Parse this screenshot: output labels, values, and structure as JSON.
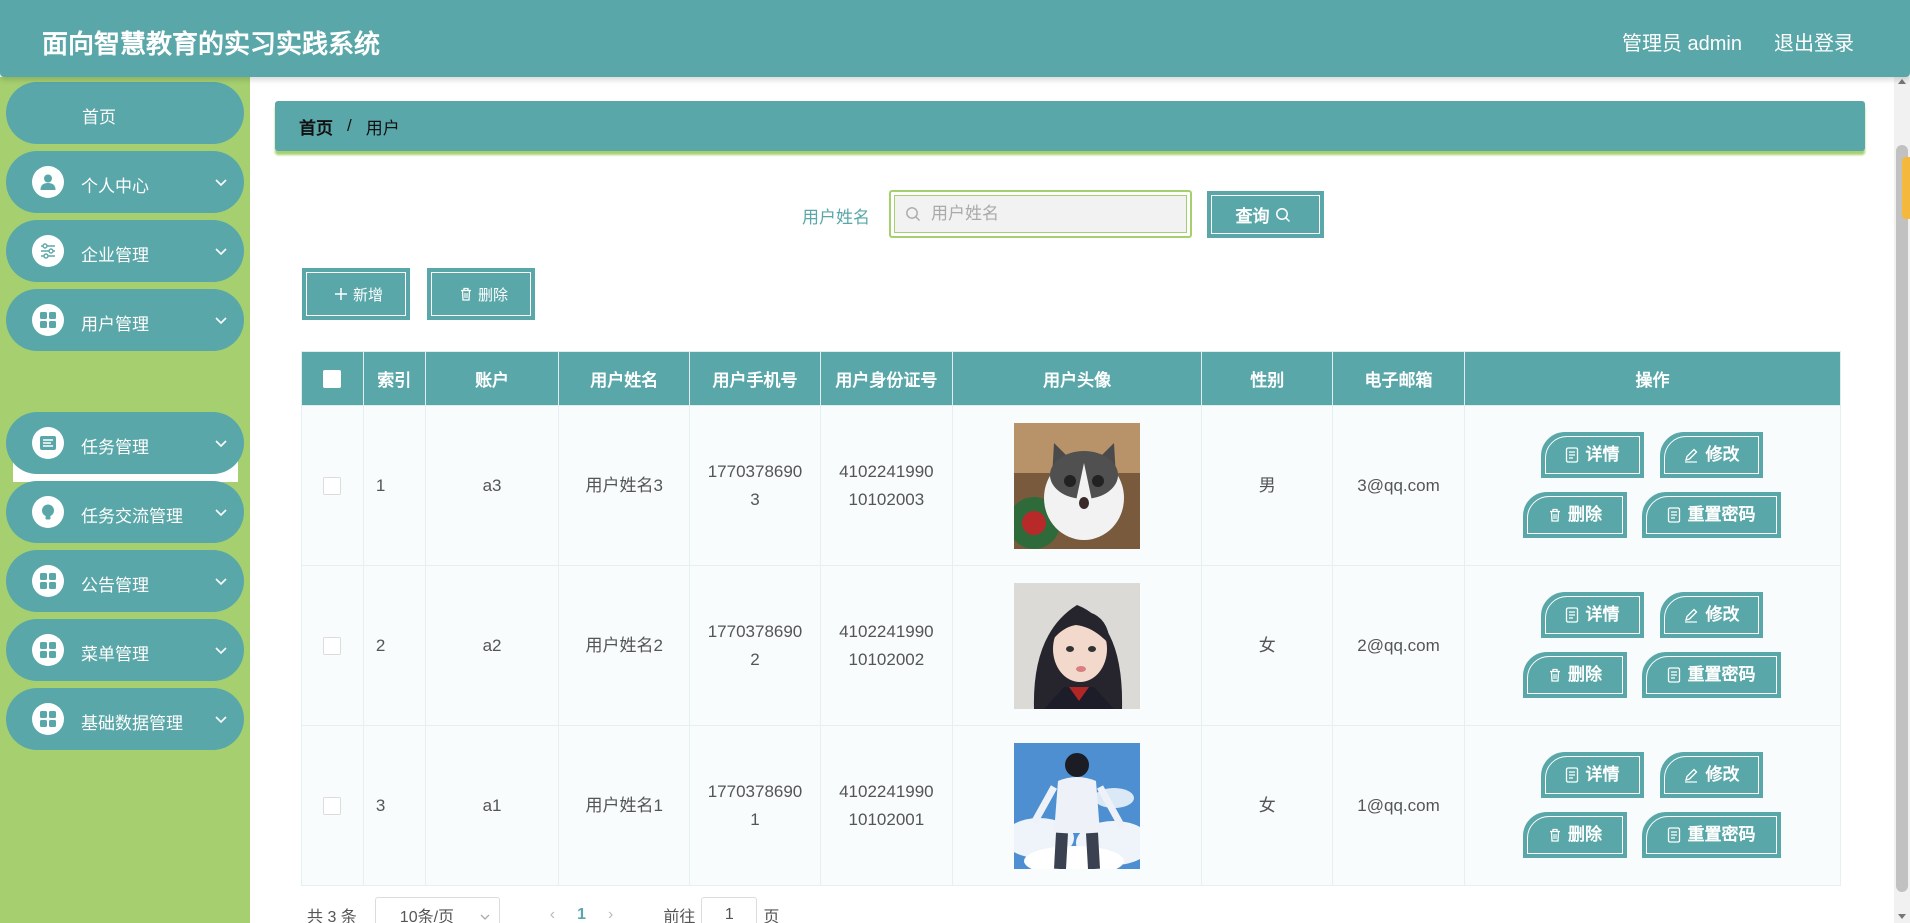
{
  "header": {
    "title": "面向智慧教育的实习实践系统",
    "user": "管理员 admin",
    "logout": "退出登录"
  },
  "sidebar": {
    "items": [
      {
        "label": "首页"
      },
      {
        "label": "个人中心"
      },
      {
        "label": "企业管理"
      },
      {
        "label": "用户管理"
      },
      {
        "label": "任务管理"
      },
      {
        "label": "任务交流管理"
      },
      {
        "label": "公告管理"
      },
      {
        "label": "菜单管理"
      },
      {
        "label": "基础数据管理"
      }
    ],
    "submenu": "用户"
  },
  "breadcrumb": {
    "home": "首页",
    "separator": "/",
    "current": "用户"
  },
  "search": {
    "label": "用户姓名",
    "placeholder": "用户姓名",
    "query_label": "查询"
  },
  "toolbar": {
    "add_label": "新增",
    "delete_label": "删除"
  },
  "table": {
    "columns": [
      "索引",
      "账户",
      "用户姓名",
      "用户手机号",
      "用户身份证号",
      "用户头像",
      "性别",
      "电子邮箱",
      "操作"
    ],
    "rows": [
      {
        "index": "1",
        "account": "a3",
        "name": "用户姓名3",
        "phone_a": "1770378690",
        "phone_b": "3",
        "id_a": "4102241990",
        "id_b": "10102003",
        "gender": "男",
        "email": "3@qq.com"
      },
      {
        "index": "2",
        "account": "a2",
        "name": "用户姓名2",
        "phone_a": "1770378690",
        "phone_b": "2",
        "id_a": "4102241990",
        "id_b": "10102002",
        "gender": "女",
        "email": "2@qq.com"
      },
      {
        "index": "3",
        "account": "a1",
        "name": "用户姓名1",
        "phone_a": "1770378690",
        "phone_b": "1",
        "id_a": "4102241990",
        "id_b": "10102001",
        "gender": "女",
        "email": "1@qq.com"
      }
    ],
    "ops": {
      "detail": "详情",
      "edit": "修改",
      "delete": "删除",
      "reset": "重置密码"
    }
  },
  "pagination": {
    "total": "共 3 条",
    "page_size": "10条/页",
    "current_page": "1",
    "goto_label": "前往",
    "goto_value": "1",
    "page_suffix": "页"
  },
  "colors": {
    "primary": "#5aa7a9",
    "sidebar": "#a6d06f"
  }
}
